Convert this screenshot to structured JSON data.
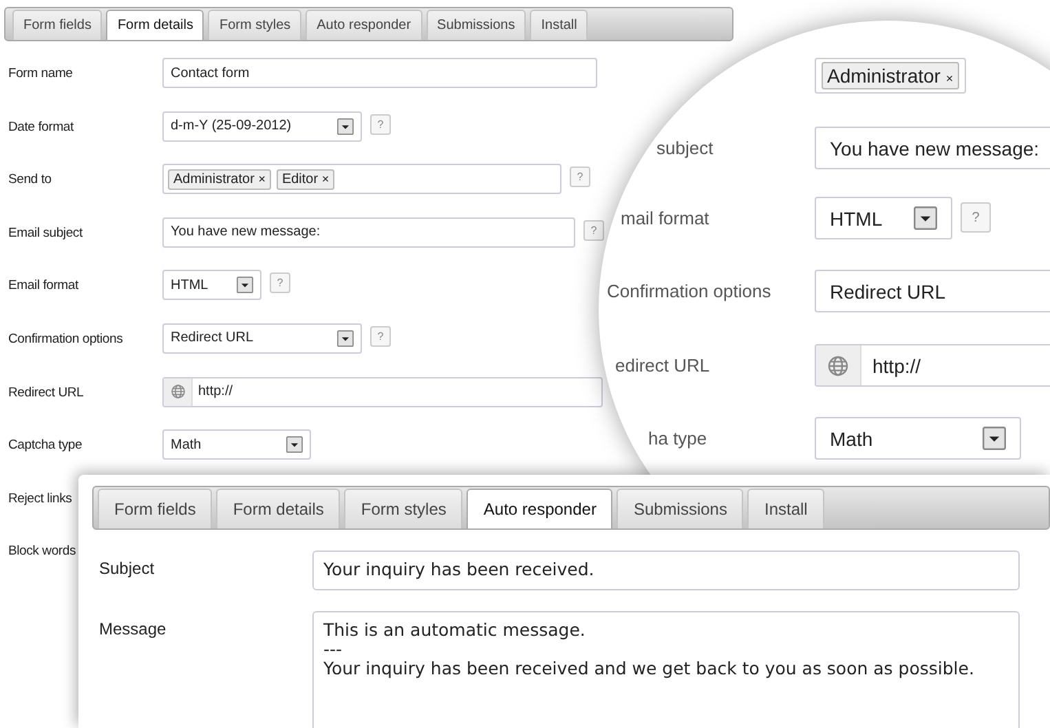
{
  "back_window": {
    "tabs": [
      {
        "label": "Form fields",
        "selected": false
      },
      {
        "label": "Form details",
        "selected": true
      },
      {
        "label": "Form styles",
        "selected": false
      },
      {
        "label": "Auto responder",
        "selected": false
      },
      {
        "label": "Submissions",
        "selected": false
      },
      {
        "label": "Install",
        "selected": false
      }
    ],
    "rows": [
      {
        "kind": "text",
        "label": "Form name",
        "value": "Contact form"
      },
      {
        "kind": "select",
        "label": "Date format",
        "value": "d-m-Y (25-09-2012)",
        "help": "?"
      },
      {
        "kind": "tags",
        "label": "Send to",
        "tags": [
          {
            "label": "Administrator",
            "remove": "×"
          },
          {
            "label": "Editor",
            "remove": "×"
          }
        ],
        "help": "?"
      },
      {
        "kind": "text",
        "label": "Email subject",
        "value": "You have new message:",
        "help": "?"
      },
      {
        "kind": "select",
        "label": "Email format",
        "value": "HTML",
        "help": "?"
      },
      {
        "kind": "select",
        "label": "Confirmation options",
        "value": "Redirect URL",
        "help": "?"
      },
      {
        "kind": "url",
        "label": "Redirect URL",
        "value": "http://"
      },
      {
        "kind": "select",
        "label": "Captcha type",
        "value": "Math"
      },
      {
        "kind": "label",
        "label": "Reject links"
      },
      {
        "kind": "label",
        "label": "Block words"
      }
    ]
  },
  "magnifier": {
    "rows": [
      {
        "kind": "tags",
        "tags": [
          {
            "label": "Administrator",
            "remove": "×"
          }
        ]
      },
      {
        "kind": "text",
        "label": "subject",
        "value": "You have new message:"
      },
      {
        "kind": "select",
        "label": "mail format",
        "value": "HTML",
        "help": "?"
      },
      {
        "kind": "text",
        "label": "Confirmation options",
        "value": "Redirect URL"
      },
      {
        "kind": "url",
        "label": "edirect URL",
        "value": "http://"
      },
      {
        "kind": "select",
        "label": "ha type",
        "value": "Math"
      }
    ]
  },
  "front_window": {
    "tabs": [
      {
        "label": "Form fields",
        "selected": false
      },
      {
        "label": "Form details",
        "selected": false
      },
      {
        "label": "Form styles",
        "selected": false
      },
      {
        "label": "Auto responder",
        "selected": true
      },
      {
        "label": "Submissions",
        "selected": false
      },
      {
        "label": "Install",
        "selected": false
      }
    ],
    "subject": {
      "label": "Subject",
      "value": "Your inquiry has been received."
    },
    "message": {
      "label": "Message",
      "lines": [
        "This is an automatic message.",
        "---",
        "Your inquiry has been received and we get back to you as soon as possible."
      ]
    }
  }
}
